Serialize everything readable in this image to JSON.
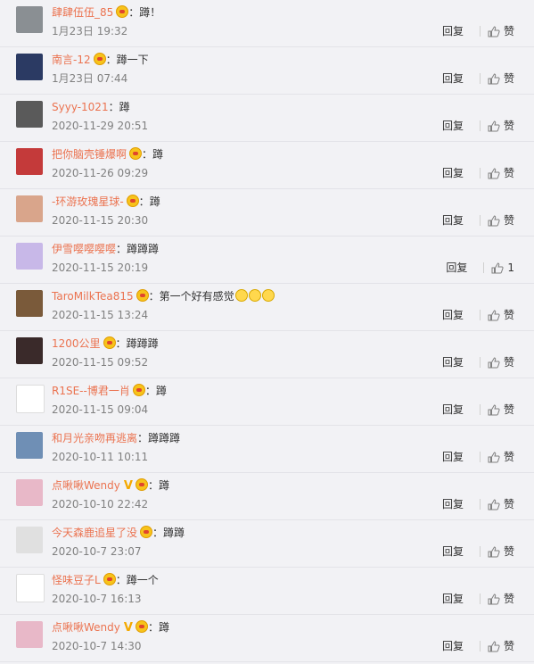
{
  "comments": [
    {
      "user": "肆肆伍伍_85",
      "badge": true,
      "v": false,
      "text": "蹲！",
      "emojis": 0,
      "time": "1月23日 19:32",
      "reply": "回复",
      "like": "赞",
      "avatar_color": "#8a8f93"
    },
    {
      "user": "南言-12",
      "badge": true,
      "v": false,
      "text": "蹲一下",
      "emojis": 0,
      "time": "1月23日 07:44",
      "reply": "回复",
      "like": "赞",
      "avatar_color": "#2b3a63"
    },
    {
      "user": "Syyy-1021",
      "badge": false,
      "v": false,
      "text": "蹲",
      "emojis": 0,
      "time": "2020-11-29 20:51",
      "reply": "回复",
      "like": "赞",
      "avatar_color": "#5a5a5a"
    },
    {
      "user": "把你脑壳锤爆啊",
      "badge": true,
      "v": false,
      "text": "蹲",
      "emojis": 0,
      "time": "2020-11-26 09:29",
      "reply": "回复",
      "like": "赞",
      "avatar_color": "#c43a3a"
    },
    {
      "user": "-环游玫瑰星球-",
      "badge": true,
      "v": false,
      "text": "蹲",
      "emojis": 0,
      "time": "2020-11-15 20:30",
      "reply": "回复",
      "like": "赞",
      "avatar_color": "#d9a58b"
    },
    {
      "user": "伊雪嘤嘤嘤嘤",
      "badge": false,
      "v": false,
      "text": "蹲蹲蹲",
      "emojis": 0,
      "time": "2020-11-15 20:19",
      "reply": "回复",
      "like": "1",
      "avatar_color": "#c8b8e8"
    },
    {
      "user": "TaroMilkTea815",
      "badge": true,
      "v": false,
      "text": "第一个好有感觉",
      "emojis": 3,
      "time": "2020-11-15 13:24",
      "reply": "回复",
      "like": "赞",
      "avatar_color": "#7a5a3a"
    },
    {
      "user": "1200公里",
      "badge": true,
      "v": false,
      "text": "蹲蹲蹲",
      "emojis": 0,
      "time": "2020-11-15 09:52",
      "reply": "回复",
      "like": "赞",
      "avatar_color": "#3a2a2a"
    },
    {
      "user": "R1SE--博君一肖",
      "badge": true,
      "v": false,
      "text": "蹲",
      "emojis": 0,
      "time": "2020-11-15 09:04",
      "reply": "回复",
      "like": "赞",
      "avatar_color": "#ffffff"
    },
    {
      "user": "和月光亲吻再逃离",
      "badge": false,
      "v": false,
      "text": "蹲蹲蹲",
      "emojis": 0,
      "time": "2020-10-11 10:11",
      "reply": "回复",
      "like": "赞",
      "avatar_color": "#6f8fb5"
    },
    {
      "user": "点啾啾Wendy",
      "badge": true,
      "v": true,
      "text": "蹲",
      "emojis": 0,
      "time": "2020-10-10 22:42",
      "reply": "回复",
      "like": "赞",
      "avatar_color": "#e8b8c8"
    },
    {
      "user": "今天森鹿追星了没",
      "badge": true,
      "v": false,
      "text": "蹲蹲",
      "emojis": 0,
      "time": "2020-10-7 23:07",
      "reply": "回复",
      "like": "赞",
      "avatar_color": "#e0e0e0"
    },
    {
      "user": "怪味豆子L",
      "badge": true,
      "v": false,
      "text": "蹲一个",
      "emojis": 0,
      "time": "2020-10-7 16:13",
      "reply": "回复",
      "like": "赞",
      "avatar_color": "#ffffff"
    },
    {
      "user": "点啾啾Wendy",
      "badge": true,
      "v": true,
      "text": "蹲",
      "emojis": 0,
      "time": "2020-10-7 14:30",
      "reply": "回复",
      "like": "赞",
      "avatar_color": "#e8b8c8"
    }
  ]
}
